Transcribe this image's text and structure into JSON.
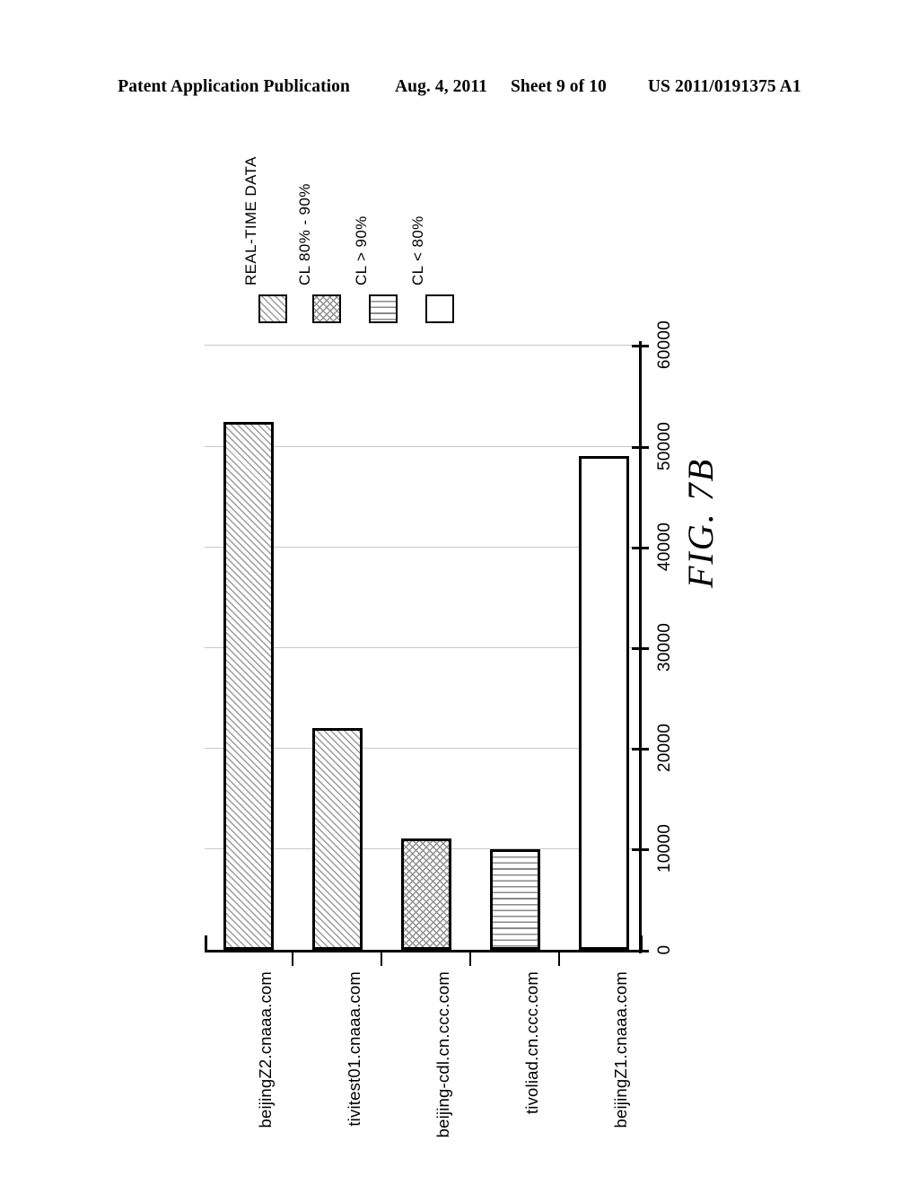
{
  "header": {
    "publication": "Patent Application Publication",
    "date": "Aug. 4, 2011",
    "sheet": "Sheet 9 of 10",
    "patent_number": "US 2011/0191375 A1"
  },
  "figure": {
    "caption": "FIG. 7B"
  },
  "legend": {
    "entries": [
      {
        "label": "REAL-TIME DATA",
        "pattern": "diagonal"
      },
      {
        "label": "CL 80% - 90%",
        "pattern": "crosshatch"
      },
      {
        "label": "CL > 90%",
        "pattern": "horizontal"
      },
      {
        "label": "CL < 80%",
        "pattern": "empty"
      }
    ]
  },
  "chart_data": {
    "type": "bar",
    "title": "FIG. 7B",
    "orientation": "vertical-bars-rotated-page",
    "categories": [
      "beijingZ2.cnaaa.com",
      "tivitest01.cnaaa.com",
      "beijing-cdl.cn.ccc.com",
      "tivoliad.cn.ccc.com",
      "beijingZ1.cnaaa.com"
    ],
    "values": [
      52300,
      22000,
      11000,
      10000,
      49000
    ],
    "patterns": [
      "diagonal",
      "diagonal",
      "crosshatch",
      "horizontal",
      "empty"
    ],
    "series": [
      {
        "name": "REAL-TIME DATA",
        "values": [
          52300,
          22000,
          11000,
          10000,
          49000
        ]
      }
    ],
    "xlabel": "",
    "ylabel": "",
    "ylim": [
      0,
      60000
    ],
    "yticks": [
      0,
      10000,
      20000,
      30000,
      40000,
      50000,
      60000
    ],
    "ytick_labels": [
      "0",
      "10000",
      "20000",
      "30000",
      "40000",
      "50000",
      "60000"
    ],
    "grid": true,
    "legend_position": "top-left",
    "legend_entries": [
      "REAL-TIME DATA",
      "CL 80% - 90%",
      "CL > 90%",
      "CL < 80%"
    ]
  }
}
